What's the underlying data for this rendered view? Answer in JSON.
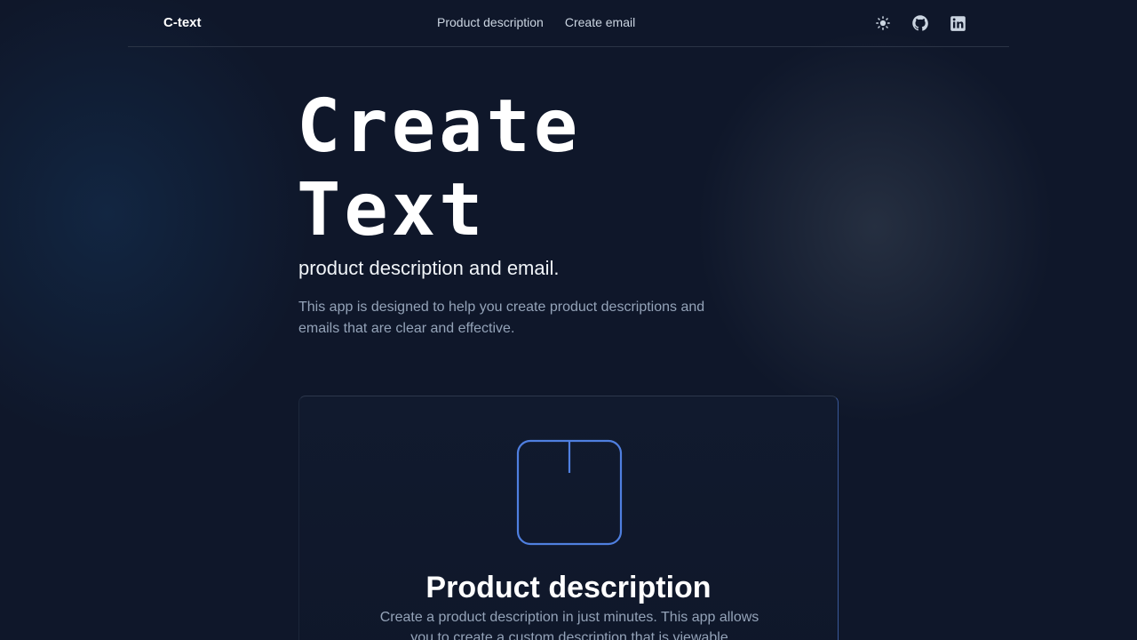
{
  "header": {
    "brand": "C-text",
    "nav": [
      {
        "label": "Product description"
      },
      {
        "label": "Create email"
      }
    ],
    "icons": [
      "sun-icon",
      "github-icon",
      "linkedin-icon"
    ]
  },
  "hero": {
    "title_line1": "Create",
    "title_line2": "Text",
    "subtitle": "product description and email.",
    "description": "This app is designed to help you create product descriptions and emails that are clear and effective."
  },
  "card": {
    "icon": "box-icon",
    "accent_color": "#4f7fe0",
    "title": "Product description",
    "description": "Create a product description in just minutes. This app allows you to create a custom description that is viewable"
  },
  "colors": {
    "background": "#0f172a",
    "text_primary": "#ffffff",
    "text_muted": "#94a3b8"
  }
}
